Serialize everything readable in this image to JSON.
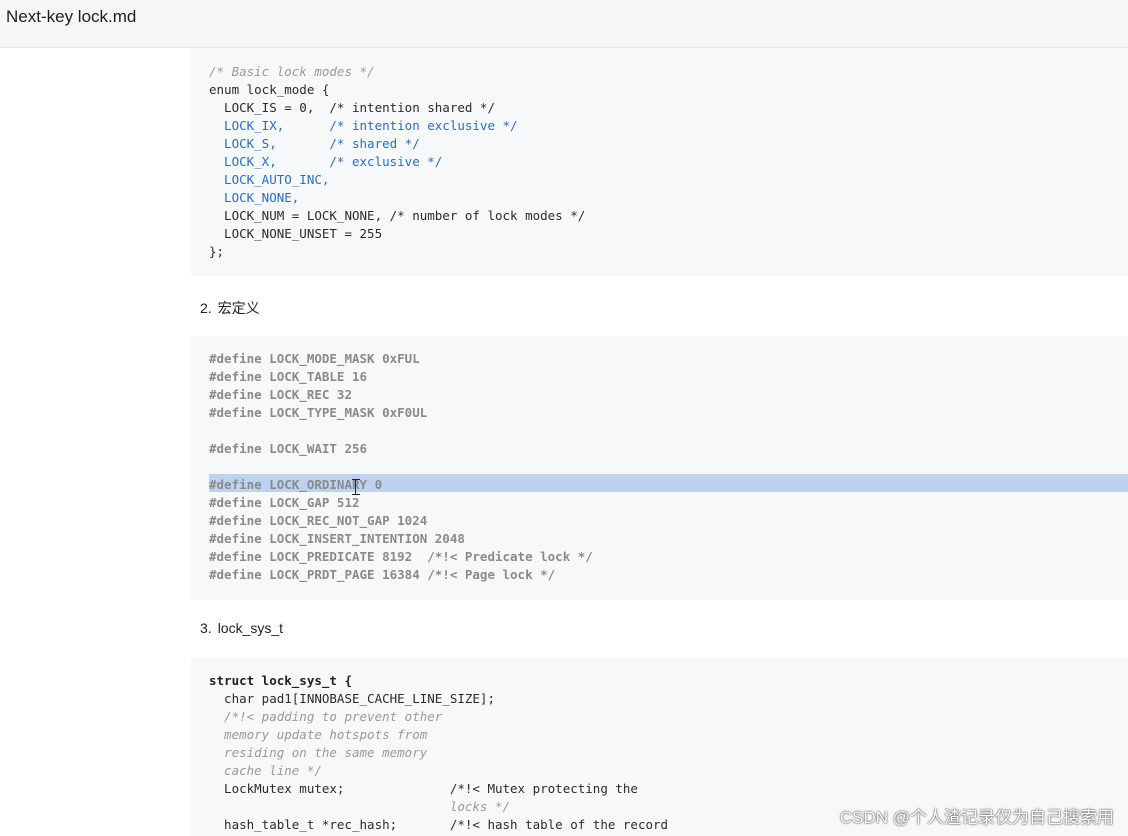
{
  "window": {
    "title": "Next-key lock.md"
  },
  "block1": {
    "lines": [
      "/* Basic lock modes */",
      "enum lock_mode {",
      "  LOCK_IS = 0,  /* intention shared */",
      "  LOCK_IX,      /* intention exclusive */",
      "  LOCK_S,       /* shared */",
      "  LOCK_X,       /* exclusive */",
      "  LOCK_AUTO_INC,",
      "  LOCK_NONE,",
      "  LOCK_NUM = LOCK_NONE, /* number of lock modes */",
      "  LOCK_NONE_UNSET = 255",
      "};"
    ]
  },
  "heading2": {
    "number": "2.",
    "text": "宏定义"
  },
  "block2": {
    "lines": [
      "#define LOCK_MODE_MASK 0xFUL",
      "#define LOCK_TABLE 16",
      "#define LOCK_REC 32",
      "#define LOCK_TYPE_MASK 0xF0UL",
      "",
      "#define LOCK_WAIT 256",
      "",
      "#define LOCK_ORDINARY 0",
      "#define LOCK_GAP 512",
      "#define LOCK_REC_NOT_GAP 1024",
      "#define LOCK_INSERT_INTENTION 2048",
      "#define LOCK_PREDICATE 8192  /*!< Predicate lock */",
      "#define LOCK_PRDT_PAGE 16384 /*!< Page lock */"
    ]
  },
  "heading3": {
    "number": "3.",
    "text": "lock_sys_t"
  },
  "block3": {
    "lines": [
      "struct lock_sys_t {",
      "  char pad1[INNOBASE_CACHE_LINE_SIZE];",
      "  /*!< padding to prevent other",
      "  memory update hotspots from",
      "  residing on the same memory",
      "  cache line */",
      "  LockMutex mutex;              /*!< Mutex protecting the",
      "                                locks */",
      "  hash_table_t *rec_hash;       /*!< hash table of the record"
    ]
  },
  "watermark": "CSDN @个人渣记录仅为自己搜索用"
}
